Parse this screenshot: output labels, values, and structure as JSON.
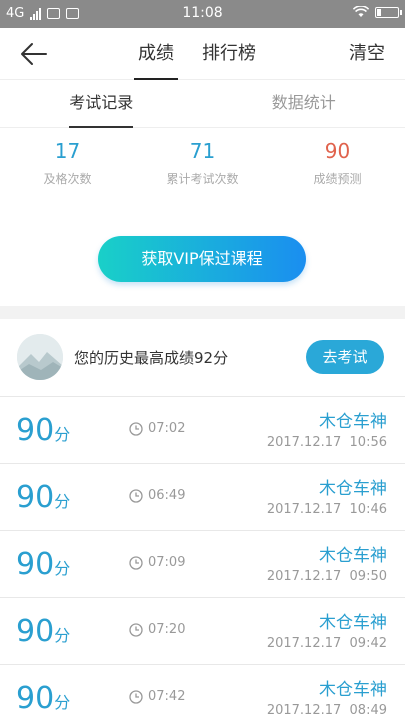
{
  "statusbar": {
    "network": "4G",
    "time": "11:08"
  },
  "nav": {
    "tabs": [
      {
        "label": "成绩"
      },
      {
        "label": "排行榜"
      }
    ],
    "clear_label": "清空"
  },
  "subtabs": [
    {
      "label": "考试记录"
    },
    {
      "label": "数据统计"
    }
  ],
  "stats": [
    {
      "value": "17",
      "label": "及格次数"
    },
    {
      "value": "71",
      "label": "累计考试次数"
    },
    {
      "value": "90",
      "label": "成绩预测"
    }
  ],
  "vip_button": "获取VIP保过课程",
  "best": {
    "text": "您的历史最高成绩92分",
    "button": "去考试"
  },
  "score_unit": "分",
  "records": [
    {
      "score": "90",
      "duration": "07:02",
      "name": "木仓车神",
      "date": "2017.12.17  10:56"
    },
    {
      "score": "90",
      "duration": "06:49",
      "name": "木仓车神",
      "date": "2017.12.17  10:46"
    },
    {
      "score": "90",
      "duration": "07:09",
      "name": "木仓车神",
      "date": "2017.12.17  09:50"
    },
    {
      "score": "90",
      "duration": "07:20",
      "name": "木仓车神",
      "date": "2017.12.17  09:42"
    },
    {
      "score": "90",
      "duration": "07:42",
      "name": "木仓车神",
      "date": "2017.12.17  08:49"
    }
  ],
  "colors": {
    "accent": "#2a9fd0",
    "prediction": "#e0624c",
    "button": "#2aa8d8"
  },
  "icons": {
    "back": "arrow-left-icon",
    "clock": "clock-icon"
  }
}
